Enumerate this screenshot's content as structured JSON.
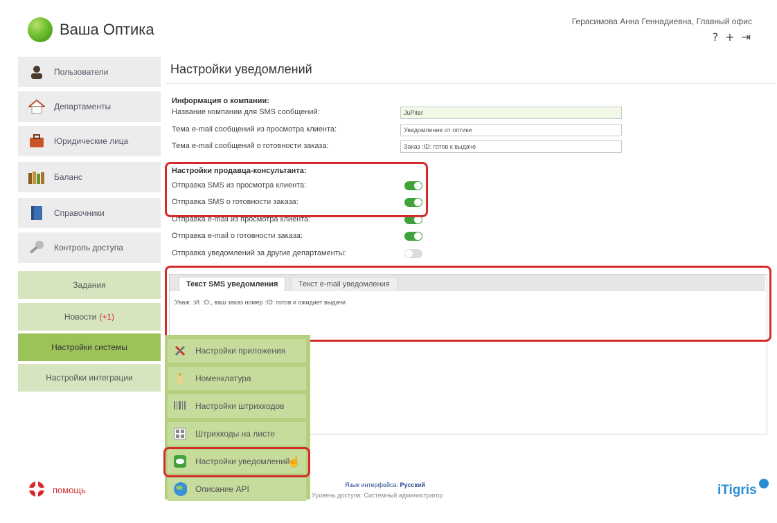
{
  "app": {
    "name": "Ваша Оптика"
  },
  "header": {
    "user": "Герасимова Анна Геннадиевна, Главный офис",
    "icons": [
      "help-icon",
      "add-icon",
      "logout-icon"
    ]
  },
  "sidebar": {
    "items": [
      {
        "label": "Пользователи",
        "icon": "user-icon"
      },
      {
        "label": "Департаменты",
        "icon": "house-icon"
      },
      {
        "label": "Юридические лица",
        "icon": "briefcase-icon"
      },
      {
        "label": "Баланс",
        "icon": "books-icon"
      },
      {
        "label": "Справочники",
        "icon": "notebook-icon"
      },
      {
        "label": "Контроль доступа",
        "icon": "key-icon"
      }
    ],
    "green_items": [
      {
        "label": "Задания"
      },
      {
        "label": "Новости",
        "badge": "(+1)"
      },
      {
        "label": "Настройки системы",
        "active": true
      },
      {
        "label": "Настройки интеграции"
      }
    ]
  },
  "main": {
    "title": "Настройки уведомлений",
    "company": {
      "heading": "Информация о компании:",
      "rows": [
        {
          "label": "Название компании для SMS сообщений:",
          "value": "JuPiter"
        },
        {
          "label": "Тема e-mail сообщений из просмотра клиента:",
          "value": "Уведомление от оптики"
        },
        {
          "label": "Тема e-mail сообщений о готовности заказа:",
          "value": "Заказ :ID: готов к выдаче"
        }
      ]
    },
    "seller": {
      "heading": "Настройки продавца-консультанта:",
      "rows": [
        {
          "label": "Отправка SMS из просмотра клиента:",
          "on": true
        },
        {
          "label": "Отправка SMS о готовности заказа:",
          "on": true
        },
        {
          "label": "Отправка e-mail из просмотра клиента:",
          "on": true
        },
        {
          "label": "Отправка e-mail о готовности заказа:",
          "on": true
        },
        {
          "label": "Отправка уведомлений за другие департаменты:",
          "on": false
        }
      ]
    },
    "tabs": [
      {
        "label": "Текст SMS уведомления",
        "active": true
      },
      {
        "label": "Текст e-mail уведомления",
        "active": false
      }
    ],
    "sms_text": ":Уваж: :И: :О:, ваш заказ номер :ID: готов и ожидает выдачи"
  },
  "submenu": {
    "items": [
      {
        "label": "Настройки приложения",
        "icon": "tools-icon"
      },
      {
        "label": "Номенклатура",
        "icon": "bottle-icon"
      },
      {
        "label": "Настройки штрихкодов",
        "icon": "barcode-icon"
      },
      {
        "label": "Штрихкоды на листе",
        "icon": "barcode-sheet-icon"
      },
      {
        "label": "Настройки уведомлений",
        "icon": "chat-icon"
      },
      {
        "label": "Описание API",
        "icon": "globe-icon"
      }
    ]
  },
  "footer": {
    "help": "помощь",
    "lang_label": "Язык интерфейса:",
    "lang_value": "Русский",
    "access": "Уровень доступа: Системный администратор",
    "brand": "iTigris"
  },
  "colors": {
    "accent_green": "#9cc35a",
    "toggle_on": "#3fa23b",
    "highlight_red": "#d52b2b"
  }
}
